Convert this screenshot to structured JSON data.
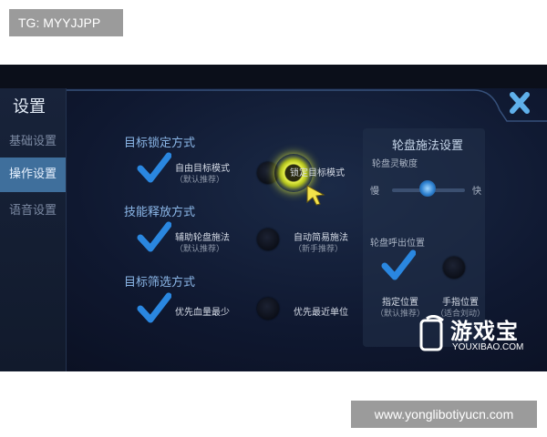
{
  "watermarks": {
    "top_tag": "TG: MYYJJPP",
    "bottom_tag": "www.yonglibotiyucn.com"
  },
  "settings": {
    "title": "设置",
    "sidebar": [
      {
        "label": "基础设置",
        "active": false
      },
      {
        "label": "操作设置",
        "active": true
      },
      {
        "label": "语音设置",
        "active": false
      }
    ],
    "sections": {
      "target_lock": {
        "heading": "目标锁定方式",
        "option_free": {
          "label": "自由目标模式",
          "sub": "（默认推荐）",
          "checked": true
        },
        "option_lock": {
          "label": "锁定目标模式",
          "checked": false
        }
      },
      "skill_release": {
        "heading": "技能释放方式",
        "option_wheel": {
          "label": "辅助轮盘施法",
          "sub": "（默认推荐）",
          "checked": true
        },
        "option_auto": {
          "label": "自动简易施法",
          "sub": "（新手推荐）",
          "checked": false
        }
      },
      "target_filter": {
        "heading": "目标筛选方式",
        "option_low_hp": {
          "label": "优先血量最少",
          "checked": true
        },
        "option_nearest": {
          "label": "优先最近单位",
          "checked": false
        }
      }
    },
    "wheel_panel": {
      "title": "轮盘施法设置",
      "sensitivity_label": "轮盘灵敏度",
      "slow": "慢",
      "fast": "快",
      "sensitivity_level": 0.5,
      "popup_label": "轮盘呼出位置",
      "option_fixed": {
        "label": "指定位置",
        "sub": "（默认推荐）",
        "checked": true
      },
      "option_finger": {
        "label": "手指位置",
        "sub": "（适合刘动）",
        "checked": false
      }
    }
  },
  "brand": {
    "logo_text": "游戏宝",
    "logo_sub": "YOUXIBAO.COM"
  },
  "colors": {
    "accent": "#2f7fd0",
    "active_tab": "#3f6f9c",
    "check": "#2a87e0",
    "glow": "#e7f14a"
  }
}
